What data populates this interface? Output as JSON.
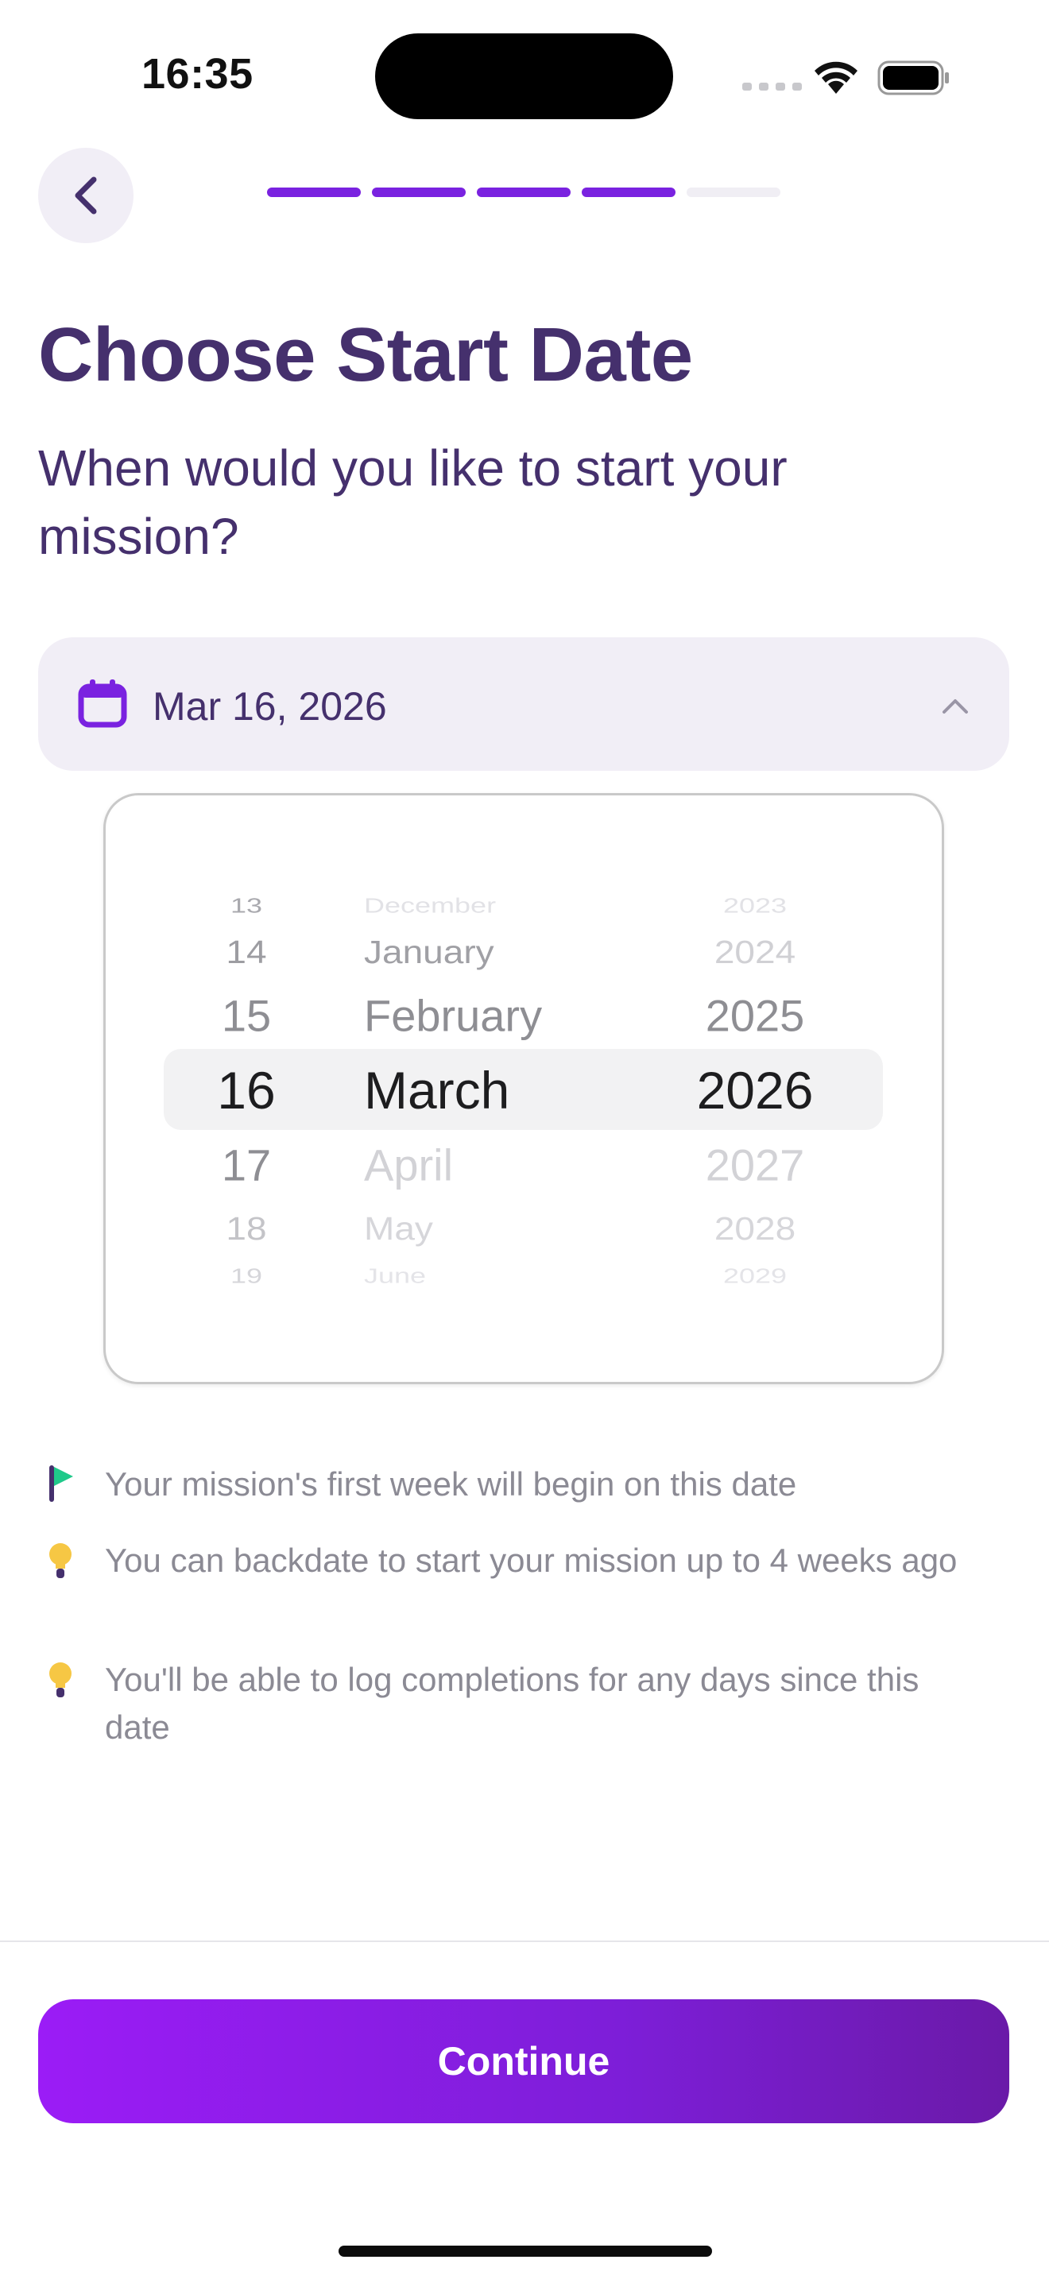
{
  "status_bar": {
    "time": "16:35"
  },
  "header": {
    "progress": {
      "total_steps": 5,
      "completed_steps": 4
    }
  },
  "page": {
    "title": "Choose Start Date",
    "subtitle": "When would you like to start your mission?"
  },
  "date_field": {
    "value": "Mar 16, 2026",
    "expanded": true
  },
  "picker": {
    "days": [
      "13",
      "14",
      "15",
      "16",
      "17",
      "18",
      "19"
    ],
    "months": [
      "December",
      "January",
      "February",
      "March",
      "April",
      "May",
      "June"
    ],
    "years": [
      "2023",
      "2024",
      "2025",
      "2026",
      "2027",
      "2028",
      "2029"
    ],
    "selected": {
      "day": "16",
      "month": "March",
      "year": "2026"
    }
  },
  "notes": [
    {
      "icon": "flag-icon",
      "text": "Your mission's first week will begin on this date"
    },
    {
      "icon": "lightbulb-icon",
      "text": "You can backdate to start your mission up to 4 weeks ago"
    },
    {
      "icon": "lightbulb-icon",
      "text": "You'll be able to log completions for any days since this date"
    }
  ],
  "footer": {
    "continue_label": "Continue"
  },
  "colors": {
    "accent": "#7a22e0",
    "heading": "#45306d",
    "muted_text": "#8b8a94",
    "field_background": "#f1eef6",
    "flag_green": "#1fc98a",
    "bulb_yellow": "#f6c744"
  }
}
